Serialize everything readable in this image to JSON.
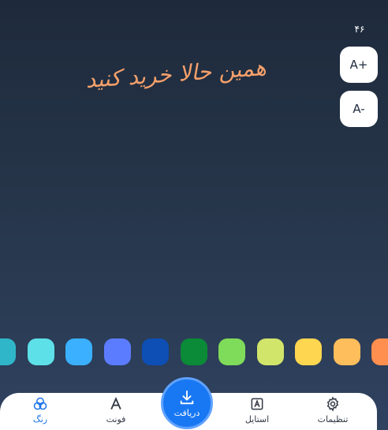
{
  "font_size": {
    "value": "۴۶",
    "increase_label": "A+",
    "decrease_label": "A-"
  },
  "preview": {
    "text": "همین حالا خرید کنید",
    "color": "#f5a06b"
  },
  "swatches": [
    {
      "name": "teal",
      "color": "#2fb6c9"
    },
    {
      "name": "cyan-light",
      "color": "#5ee0e8"
    },
    {
      "name": "sky-blue",
      "color": "#3ab0ff"
    },
    {
      "name": "periwinkle",
      "color": "#5c7cff"
    },
    {
      "name": "royal-blue",
      "color": "#0d4fb5"
    },
    {
      "name": "green-dark",
      "color": "#0b8a38"
    },
    {
      "name": "green-light",
      "color": "#7fdb5a"
    },
    {
      "name": "lime",
      "color": "#d2e56b"
    },
    {
      "name": "yellow",
      "color": "#ffd64f"
    },
    {
      "name": "amber",
      "color": "#ffbe5c"
    },
    {
      "name": "orange",
      "color": "#ff8f4f"
    }
  ],
  "nav": {
    "settings": {
      "label": "تنظیمات",
      "icon": "gear-icon"
    },
    "style": {
      "label": "استایل",
      "icon": "style-icon"
    },
    "download": {
      "label": "دریافت",
      "icon": "download-icon"
    },
    "font": {
      "label": "فونت",
      "icon": "font-icon"
    },
    "color": {
      "label": "رنگ",
      "icon": "color-circles-icon"
    }
  },
  "colors": {
    "accent": "#1877f2",
    "background": "#263549",
    "active_nav": "#1a73e8"
  }
}
